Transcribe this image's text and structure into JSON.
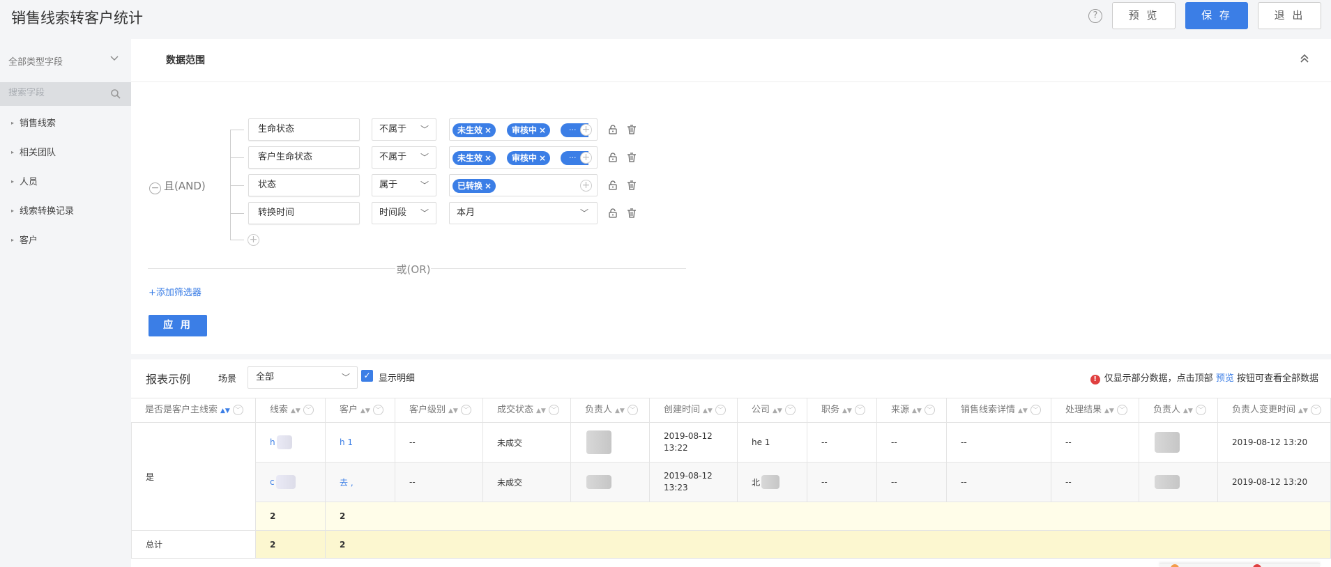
{
  "header": {
    "title": "销售线索转客户统计",
    "help": "?",
    "preview_label": "预 览",
    "save_label": "保 存",
    "exit_label": "退 出"
  },
  "sidebar": {
    "field_type": "全部类型字段",
    "search_placeholder": "搜索字段",
    "items": [
      {
        "label": "销售线索"
      },
      {
        "label": "相关团队"
      },
      {
        "label": "人员"
      },
      {
        "label": "线索转换记录"
      },
      {
        "label": "客户"
      }
    ]
  },
  "filter": {
    "section_title": "数据范围",
    "logic_label": "且(AND)",
    "conditions": [
      {
        "field": "生命状态",
        "operator": "不属于",
        "tags": [
          "未生效",
          "审核中"
        ],
        "more": "···"
      },
      {
        "field": "客户生命状态",
        "operator": "不属于",
        "tags": [
          "未生效",
          "审核中"
        ],
        "more": "···"
      },
      {
        "field": "状态",
        "operator": "属于",
        "tags": [
          "已转换"
        ]
      },
      {
        "field": "转换时间",
        "operator": "时间段",
        "value": "本月"
      }
    ],
    "or_label": "或(OR)",
    "add_filter_label": "+添加筛选器",
    "apply_label": "应 用"
  },
  "report": {
    "title": "报表示例",
    "scene_label": "场景",
    "scene_value": "全部",
    "show_detail_label": "显示明细",
    "show_detail_checked": true,
    "notice_prefix": "仅显示部分数据，点击顶部",
    "notice_link": "预览",
    "notice_suffix": "按钮可查看全部数据",
    "columns": [
      "是否是客户主线索",
      "线索",
      "客户",
      "客户级别",
      "成交状态",
      "负责人",
      "创建时间",
      "公司",
      "职务",
      "来源",
      "销售线索详情",
      "处理结果",
      "负责人",
      "负责人变更时间"
    ],
    "group_value": "是",
    "rows": [
      {
        "lead": "h",
        "customer": "h 1",
        "level": "--",
        "deal": "未成交",
        "created_line1": "2019-08-12",
        "created_line2": "13:22",
        "company": "he 1",
        "position": "--",
        "source": "--",
        "detail": "--",
        "result": "--",
        "changed": "2019-08-12 13:20"
      },
      {
        "lead": "c",
        "customer": "去 ,",
        "level": "--",
        "deal": "未成交",
        "created_line1": "2019-08-12",
        "created_line2": "13:23",
        "company": "北",
        "position": "--",
        "source": "--",
        "detail": "--",
        "result": "--",
        "changed": "2019-08-12 13:20"
      }
    ],
    "subtotal": {
      "lead": "2",
      "customer": "2"
    },
    "total": {
      "label": "总计",
      "lead": "2",
      "customer": "2"
    }
  },
  "colors": {
    "accent": "#3b7ee6",
    "warning": "#e04040",
    "subtotal_bg": "#fffde9",
    "total_bg": "#fcf7d0"
  }
}
